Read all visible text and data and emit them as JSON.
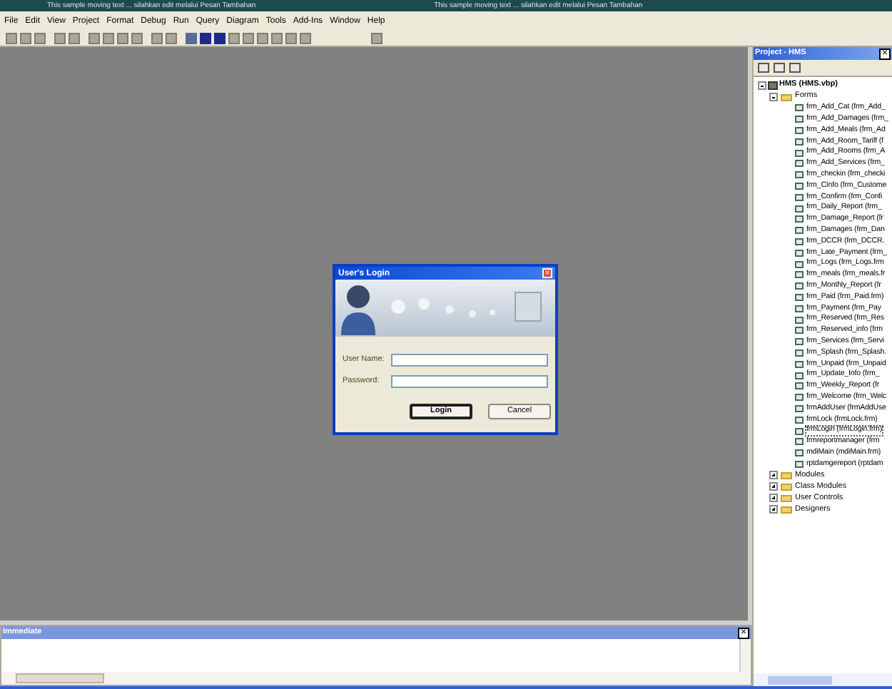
{
  "banner_texts": [
    "This sample moving text ... silahkan edit melalui Pesan Tambahan",
    "This sample moving text ... silahkan edit melalui Pesan Tambahan"
  ],
  "menu": [
    "File",
    "Edit",
    "View",
    "Project",
    "Format",
    "Debug",
    "Run",
    "Query",
    "Diagram",
    "Tools",
    "Add-Ins",
    "Window",
    "Help"
  ],
  "dialog": {
    "title": "User's Login",
    "close": "×",
    "fields": [
      {
        "label": "User Name:"
      },
      {
        "label": "Password:"
      }
    ],
    "buttons": [
      {
        "label": "Login",
        "default": true
      },
      {
        "label": "Cancel",
        "default": false
      }
    ]
  },
  "project": {
    "title": "Project - HMS",
    "close": "×",
    "root": {
      "label": "HMS (HMS.vbp)",
      "expanded": true,
      "folders": [
        {
          "label": "Forms",
          "expanded": true,
          "children": [
            {
              "label": "frm_Add_Cat (frm_Add_",
              "selected": false
            },
            {
              "label": "frm_Add_Damages (frm_",
              "selected": false
            },
            {
              "label": "frm_Add_Meals (frm_Ad",
              "selected": false
            },
            {
              "label": "frm_Add_Room_Tariff (f",
              "selected": false
            },
            {
              "label": "frm_Add_Rooms (frm_A",
              "selected": false
            },
            {
              "label": "frm_Add_Services (frm_",
              "selected": false
            },
            {
              "label": "frm_checkin (frm_checki",
              "selected": false
            },
            {
              "label": "frm_CInfo (frm_Custome",
              "selected": false
            },
            {
              "label": "frm_Confirm (frm_Confi",
              "selected": false
            },
            {
              "label": "frm_Daily_Report (frm_",
              "selected": false
            },
            {
              "label": "frm_Damage_Report (fr",
              "selected": false
            },
            {
              "label": "frm_Damages (frm_Dan",
              "selected": false
            },
            {
              "label": "frm_DCCR (frm_DCCR.",
              "selected": false
            },
            {
              "label": "frm_Late_Payment (frm_",
              "selected": false
            },
            {
              "label": "frm_Logs (frm_Logs.frm",
              "selected": false
            },
            {
              "label": "frm_meals (frm_meals.fr",
              "selected": false
            },
            {
              "label": "frm_Monthly_Report (fr",
              "selected": false
            },
            {
              "label": "frm_Paid (frm_Paid.frm)",
              "selected": false
            },
            {
              "label": "frm_Payment (frm_Pay",
              "selected": false
            },
            {
              "label": "frm_Reserved (frm_Res",
              "selected": false
            },
            {
              "label": "frm_Reserved_info (frm",
              "selected": false
            },
            {
              "label": "frm_Services (frm_Servi",
              "selected": false
            },
            {
              "label": "frm_Splash (frm_Splash.",
              "selected": false
            },
            {
              "label": "frm_Unpaid (frm_Unpaid",
              "selected": false
            },
            {
              "label": "frm_Update_Info (frm_",
              "selected": false
            },
            {
              "label": "frm_Weekly_Report (fr",
              "selected": false
            },
            {
              "label": "frm_Welcome (frm_Welc",
              "selected": false
            },
            {
              "label": "frmAddUser (frmAddUse",
              "selected": false
            },
            {
              "label": "frmLock (frmLock.frm)",
              "selected": false
            },
            {
              "label": "frmLogin (frmLogin.frm)",
              "selected": true
            },
            {
              "label": "frmreportmanager (frm",
              "selected": false
            },
            {
              "label": "mdiMain (mdiMain.frm)",
              "selected": false
            },
            {
              "label": "rptdamgereport (rptdam",
              "selected": false
            }
          ]
        },
        {
          "label": "Modules",
          "expanded": false
        },
        {
          "label": "Class Modules",
          "expanded": false
        },
        {
          "label": "User Controls",
          "expanded": false
        },
        {
          "label": "Designers",
          "expanded": false
        }
      ]
    }
  },
  "immediate": {
    "title": "Immediate",
    "close": "×"
  }
}
